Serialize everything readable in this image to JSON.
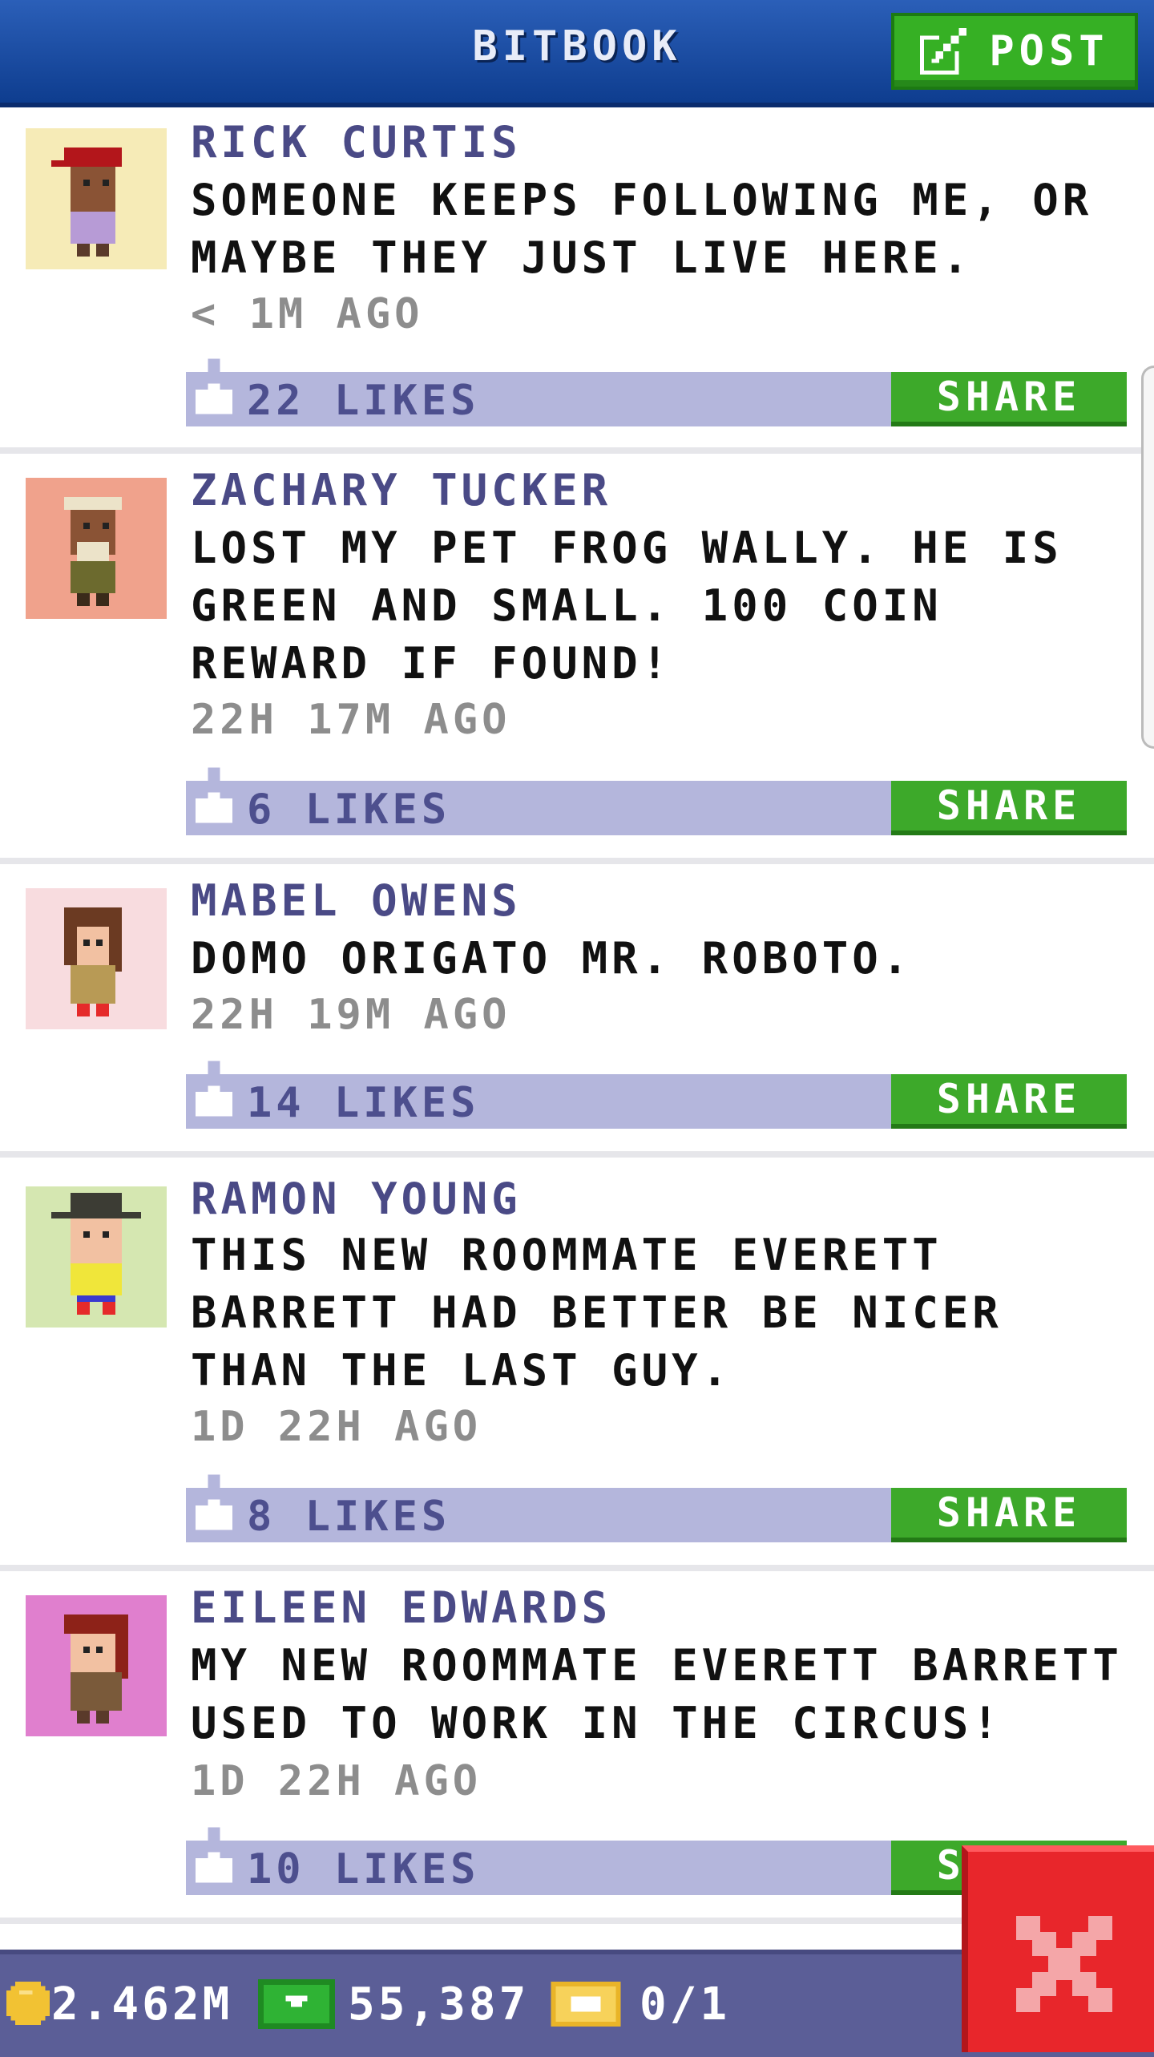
{
  "header": {
    "title": "BITBOOK",
    "post_label": "POST",
    "colors": {
      "bar": "#1a4ca6",
      "post_button": "#36b024"
    }
  },
  "posts": [
    {
      "author": "RICK CURTIS",
      "text": "SOMEONE KEEPS FOLLOWING ME, OR MAYBE THEY JUST LIVE HERE.",
      "time": "< 1M AGO",
      "likes": "22 LIKES",
      "share_label": "SHARE",
      "avatar_bg": "#f6ebb7"
    },
    {
      "author": "ZACHARY TUCKER",
      "text": "LOST MY PET FROG WALLY. HE IS GREEN AND SMALL. 100 COIN REWARD IF FOUND!",
      "time": "22H 17M AGO",
      "likes": "6 LIKES",
      "share_label": "SHARE",
      "avatar_bg": "#f0a28c"
    },
    {
      "author": "MABEL OWENS",
      "text": "DOMO ORIGATO MR. ROBOTO.",
      "time": "22H 19M AGO",
      "likes": "14 LIKES",
      "share_label": "SHARE",
      "avatar_bg": "#f8dcdf"
    },
    {
      "author": "RAMON YOUNG",
      "text": "THIS NEW ROOMMATE EVERETT BARRETT HAD BETTER BE NICER THAN THE LAST GUY.",
      "time": "1D 22H AGO",
      "likes": "8 LIKES",
      "share_label": "SHARE",
      "avatar_bg": "#d5e7b1"
    },
    {
      "author": "EILEEN EDWARDS",
      "text": "MY NEW ROOMMATE EVERETT BARRETT USED TO WORK IN THE CIRCUS!",
      "time": "1D 22H AGO",
      "likes": "10 LIKES",
      "share_label": "SHARE",
      "avatar_bg": "#e07fce"
    }
  ],
  "bottom_bar": {
    "coins": "2.462M",
    "bux": "55,387",
    "tickets": "0/1"
  },
  "icons": [
    "post-icon",
    "like-icon",
    "coin-icon",
    "bux-icon",
    "ticket-icon",
    "close-icon"
  ]
}
